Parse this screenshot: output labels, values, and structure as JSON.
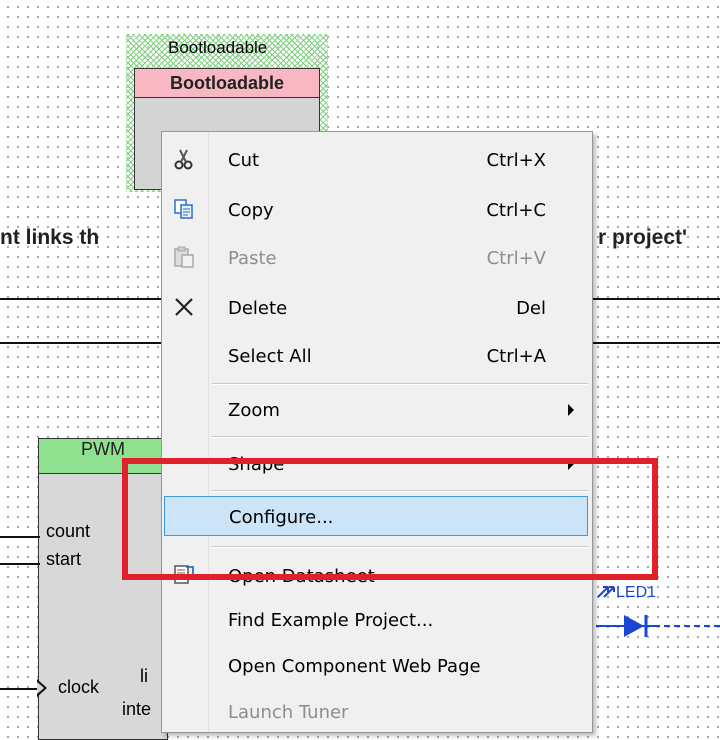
{
  "bootloadable": {
    "outer_label": "Bootloadable",
    "header_label": "Bootloadable"
  },
  "schematic_text": {
    "left_fragment": "nt links th",
    "right_fragment": "r project'"
  },
  "pwm": {
    "title": "PWM",
    "pins": [
      "count",
      "start",
      "clock"
    ],
    "partial_labels": [
      "li",
      "inte"
    ]
  },
  "led": {
    "label": "LED1"
  },
  "context_menu": {
    "items": [
      {
        "label": "Cut",
        "mnemonic": "t",
        "shortcut": "Ctrl+X",
        "icon": "scissors-icon",
        "enabled": true
      },
      {
        "label": "Copy",
        "mnemonic": "C",
        "shortcut": "Ctrl+C",
        "icon": "copy-icon",
        "enabled": true
      },
      {
        "label": "Paste",
        "mnemonic": "P",
        "shortcut": "Ctrl+V",
        "icon": "paste-icon",
        "enabled": false
      },
      {
        "label": "Delete",
        "mnemonic": "D",
        "shortcut": "Del",
        "icon": "delete-x-icon",
        "enabled": true
      },
      {
        "label": "Select All",
        "mnemonic": "A",
        "shortcut": "Ctrl+A",
        "icon": "",
        "enabled": true
      },
      {
        "label": "Zoom",
        "shortcut": "",
        "submenu": true,
        "enabled": true
      },
      {
        "label": "Shape",
        "shortcut": "",
        "submenu": true,
        "enabled": true
      },
      {
        "label": "Configure...",
        "mnemonic": "g",
        "shortcut": "",
        "highlighted": true,
        "enabled": true
      },
      {
        "label": "Open Datasheet",
        "shortcut": "",
        "icon": "datasheet-icon",
        "enabled": true
      },
      {
        "label": "Find Example Project...",
        "shortcut": "",
        "enabled": true
      },
      {
        "label": "Open Component Web Page",
        "shortcut": "",
        "enabled": true
      },
      {
        "label": "Launch Tuner",
        "shortcut": "",
        "enabled": false
      }
    ]
  },
  "colors": {
    "highlight_box": "#e0202a",
    "menu_hover_bg": "#cce4f7",
    "menu_hover_border": "#3f97df",
    "pwm_header": "#8fe08f",
    "bootloadable_header": "#f7b8c4",
    "led_blue": "#1a46d4"
  }
}
